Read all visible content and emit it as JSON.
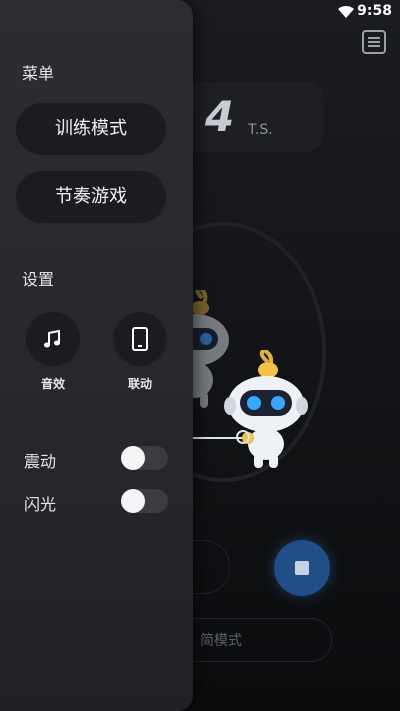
{
  "status_bar": {
    "time": "9:58"
  },
  "background": {
    "tempo_value": "4",
    "tempo_unit": "T.S.",
    "mode_label": "简模式"
  },
  "drawer": {
    "menu_title": "菜单",
    "menu_items": [
      {
        "label": "训练模式"
      },
      {
        "label": "节奏游戏"
      }
    ],
    "settings_title": "设置",
    "setting_icons": [
      {
        "label": "音效",
        "icon": "music-note-icon"
      },
      {
        "label": "联动",
        "icon": "phone-icon"
      }
    ],
    "toggles": [
      {
        "label": "震动",
        "on": false
      },
      {
        "label": "闪光",
        "on": false
      }
    ]
  },
  "colors": {
    "drawer_bg": "#2b2d33",
    "button_bg": "#1b1c20",
    "stop_button": "#1f4f86",
    "toggle_track_off": "#3a3c42"
  }
}
